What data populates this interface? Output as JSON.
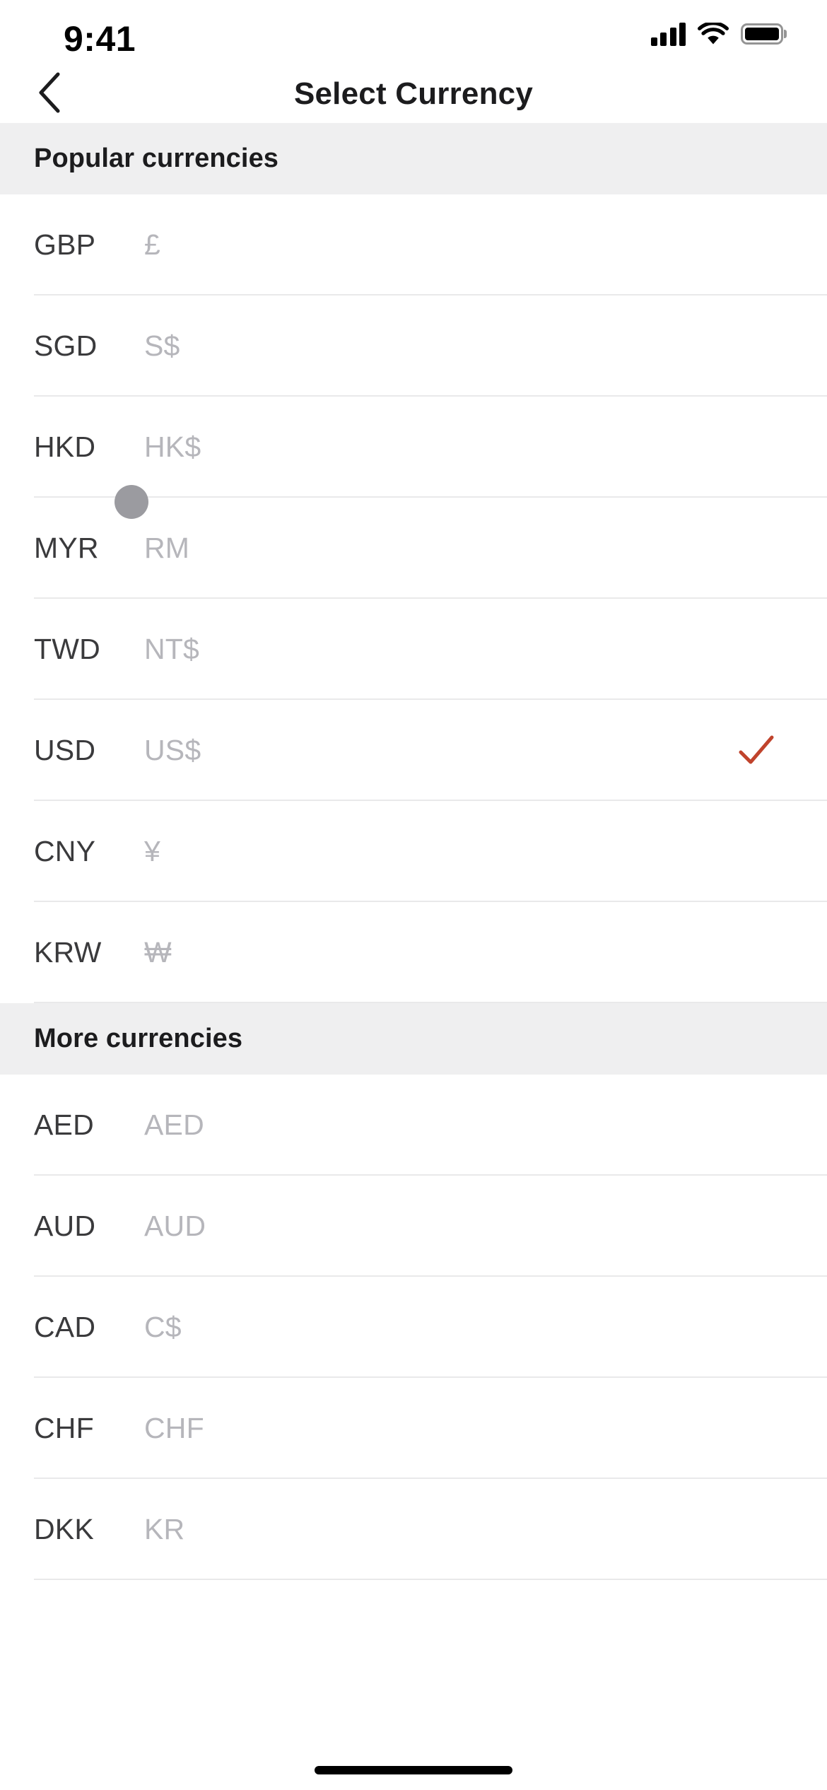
{
  "status_bar": {
    "time": "9:41",
    "cellular_icon": "cellular-signal-icon",
    "wifi_icon": "wifi-icon",
    "battery_icon": "battery-icon"
  },
  "nav": {
    "back_icon": "back-chevron-icon",
    "title": "Select Currency"
  },
  "sections": [
    {
      "title": "Popular currencies",
      "rows": [
        {
          "code": "GBP",
          "symbol": "£",
          "selected": false
        },
        {
          "code": "SGD",
          "symbol": "S$",
          "selected": false
        },
        {
          "code": "HKD",
          "symbol": "HK$",
          "selected": false
        },
        {
          "code": "MYR",
          "symbol": "RM",
          "selected": false
        },
        {
          "code": "TWD",
          "symbol": "NT$",
          "selected": false
        },
        {
          "code": "USD",
          "symbol": "US$",
          "selected": true
        },
        {
          "code": "CNY",
          "symbol": "¥",
          "selected": false
        },
        {
          "code": "KRW",
          "symbol": "₩",
          "selected": false
        }
      ]
    },
    {
      "title": "More currencies",
      "rows": [
        {
          "code": "AED",
          "symbol": "AED",
          "selected": false
        },
        {
          "code": "AUD",
          "symbol": "AUD",
          "selected": false
        },
        {
          "code": "CAD",
          "symbol": "C$",
          "selected": false
        },
        {
          "code": "CHF",
          "symbol": "CHF",
          "selected": false
        },
        {
          "code": "DKK",
          "symbol": "KR",
          "selected": false
        }
      ]
    }
  ],
  "colors": {
    "check_accent": "#c0432c",
    "section_bg": "#efeff0",
    "code_text": "#3a3a3c",
    "symbol_text": "#b6b6bb",
    "divider": "#e9e9ea",
    "touch_indicator": "#9b9ba0"
  },
  "touch_indicator": {
    "label": "touch-point-indicator"
  },
  "home_indicator": {
    "label": "home-indicator"
  }
}
